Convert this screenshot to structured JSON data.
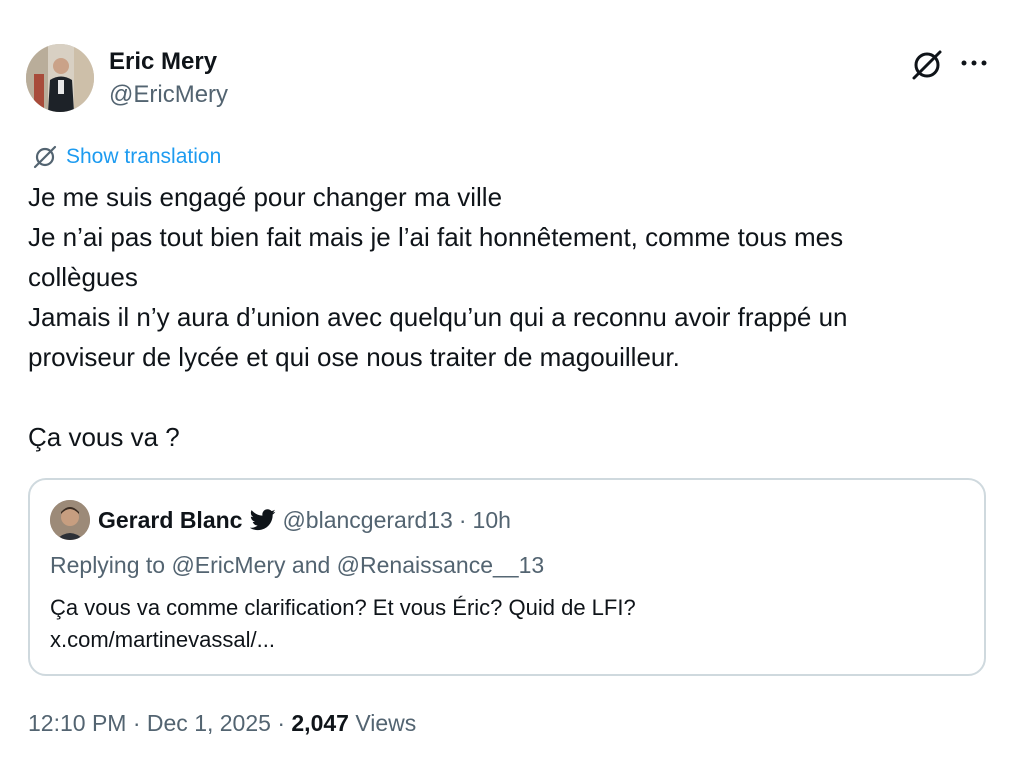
{
  "author": {
    "name": "Eric Mery",
    "handle": "@EricMery"
  },
  "header_actions": {
    "grok_icon": "grok-icon",
    "more_label": "···"
  },
  "translation": {
    "icon": "grok-icon",
    "label": "Show translation"
  },
  "post": {
    "lines": [
      "Je me suis engagé pour changer ma ville",
      "Je n’ai pas tout bien fait mais je l’ai fait honnêtement, comme tous mes",
      "collègues",
      "Jamais il n’y aura d’union avec quelqu’un qui a reconnu avoir frappé un",
      "proviseur de lycée et qui ose nous traiter de magouilleur."
    ],
    "closing": "Ça vous va ?"
  },
  "quoted": {
    "name": "Gerard Blanc",
    "bird_icon": "twitter-bird-icon",
    "handle": "@blancgerard13",
    "separator": "·",
    "time": "10h",
    "replying": "Replying to @EricMery and @Renaissance__13",
    "text_lines": [
      "Ça vous va comme clarification? Et vous Éric? Quid de LFI?",
      "x.com/martinevassal/..."
    ]
  },
  "footer": {
    "time": "12:10 PM",
    "sep1": "·",
    "date": "Dec 1, 2025",
    "sep2": "·",
    "views_count": "2,047",
    "views_label": "Views"
  },
  "colors": {
    "accent": "#1d9bf0",
    "secondary_text": "#536471",
    "border": "#cfd9de"
  }
}
